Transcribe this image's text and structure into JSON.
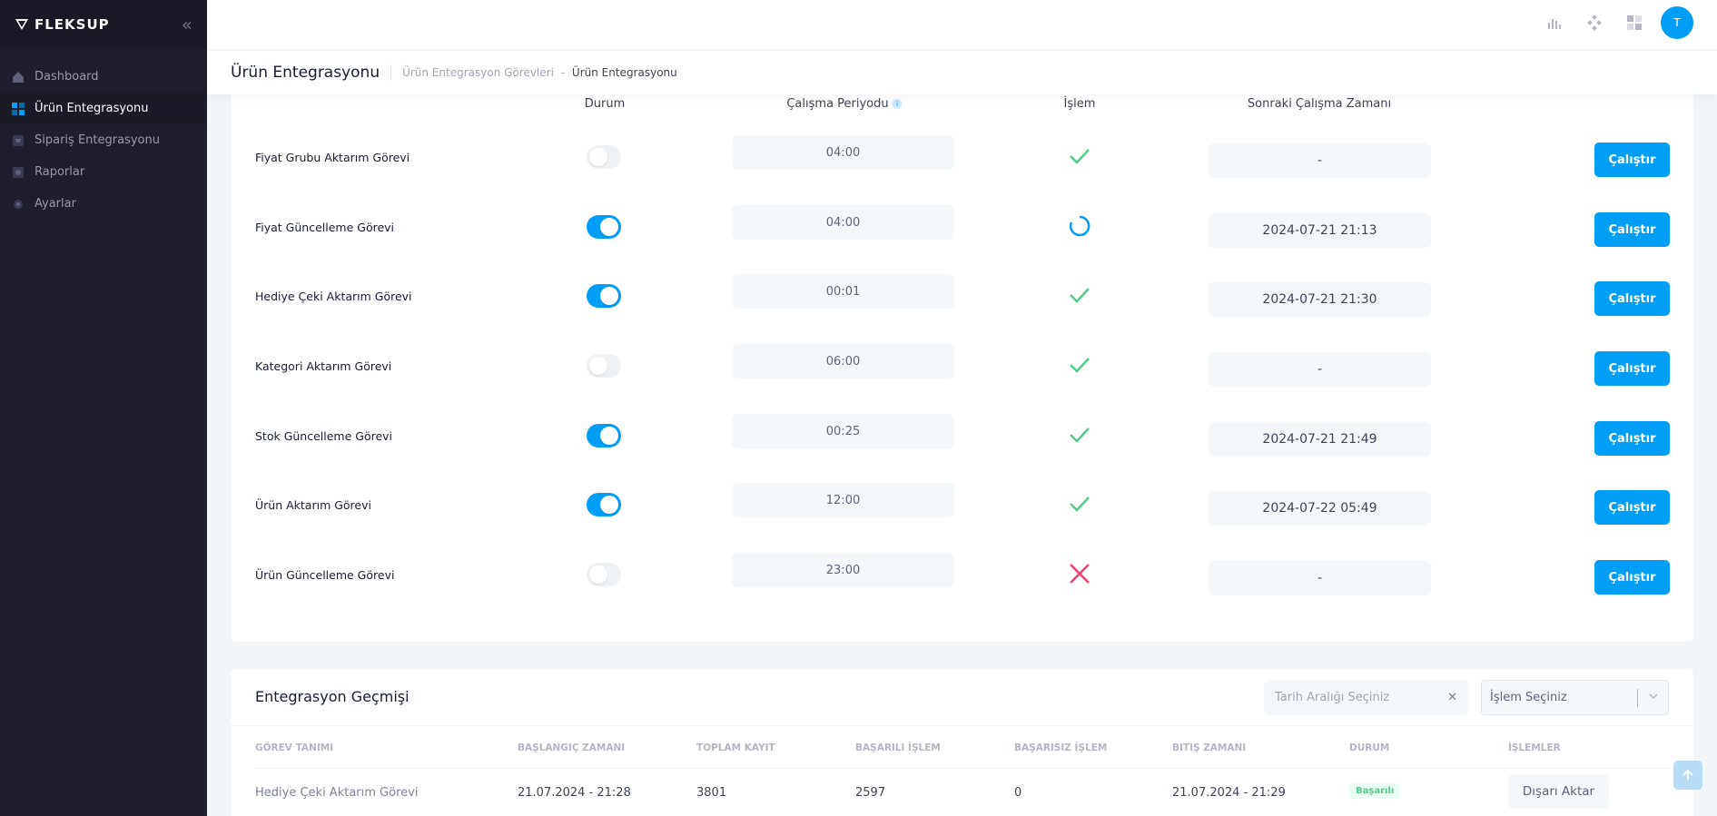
{
  "brand": {
    "name": "FLEKSUP"
  },
  "sidebar": {
    "items": [
      {
        "label": "Dashboard",
        "icon": "home-icon",
        "active": false
      },
      {
        "label": "Ürün Entegrasyonu",
        "icon": "grid-icon",
        "active": true
      },
      {
        "label": "Sipariş Entegrasyonu",
        "icon": "cart-icon",
        "active": false
      },
      {
        "label": "Raporlar",
        "icon": "report-icon",
        "active": false
      },
      {
        "label": "Ayarlar",
        "icon": "gear-icon",
        "active": false
      }
    ]
  },
  "header": {
    "avatar_initial": "T",
    "icons": [
      "chart-icon",
      "apps-icon",
      "layout-icon"
    ]
  },
  "subheader": {
    "title": "Ürün Entegrasyonu",
    "breadcrumb": [
      "Ürün Entegrasyon Görevleri",
      "Ürün Entegrasyonu"
    ]
  },
  "tasks": {
    "columns": {
      "status": "Durum",
      "period": "Çalışma Periyodu",
      "operation": "İşlem",
      "next_run": "Sonraki Çalışma Zamanı"
    },
    "info_icon": "i",
    "run_label": "Çalıştır",
    "rows": [
      {
        "name": "Fiyat Grubu Aktarım Görevi",
        "enabled": false,
        "period": "04:00",
        "state": "success",
        "next_run": "-"
      },
      {
        "name": "Fiyat Güncelleme Görevi",
        "enabled": true,
        "period": "04:00",
        "state": "running",
        "next_run": "2024-07-21 21:13"
      },
      {
        "name": "Hediye Çeki Aktarım Görevi",
        "enabled": true,
        "period": "00:01",
        "state": "success",
        "next_run": "2024-07-21 21:30"
      },
      {
        "name": "Kategori Aktarım Görevi",
        "enabled": false,
        "period": "06:00",
        "state": "success",
        "next_run": "-"
      },
      {
        "name": "Stok Güncelleme Görevi",
        "enabled": true,
        "period": "00:25",
        "state": "success",
        "next_run": "2024-07-21 21:49"
      },
      {
        "name": "Ürün Aktarım Görevi",
        "enabled": true,
        "period": "12:00",
        "state": "success",
        "next_run": "2024-07-22 05:49"
      },
      {
        "name": "Ürün Güncelleme Görevi",
        "enabled": false,
        "period": "23:00",
        "state": "failed",
        "next_run": "-"
      }
    ]
  },
  "history": {
    "title": "Entegrasyon Geçmişi",
    "date_placeholder": "Tarih Aralığı Seçiniz",
    "operation_placeholder": "İşlem Seçiniz",
    "columns": [
      "Görev Tanımı",
      "Başlangıç Zamanı",
      "Toplam Kayıt",
      "Başarılı İşlem",
      "Başarısız İşlem",
      "Bitiş Zamanı",
      "Durum",
      "İşlemler"
    ],
    "rows": [
      {
        "task": "Hediye Çeki Aktarım Görevi",
        "start": "21.07.2024 - 21:28",
        "total": "3801",
        "success": "2597",
        "failed": "0",
        "end": "21.07.2024 - 21:29",
        "status": "Başarılı",
        "action": "Dışarı Aktar"
      }
    ]
  },
  "colors": {
    "accent": "#009ef7",
    "sidebar_bg": "#1e1e2d",
    "success": "#50cd89",
    "danger": "#f1416c"
  }
}
